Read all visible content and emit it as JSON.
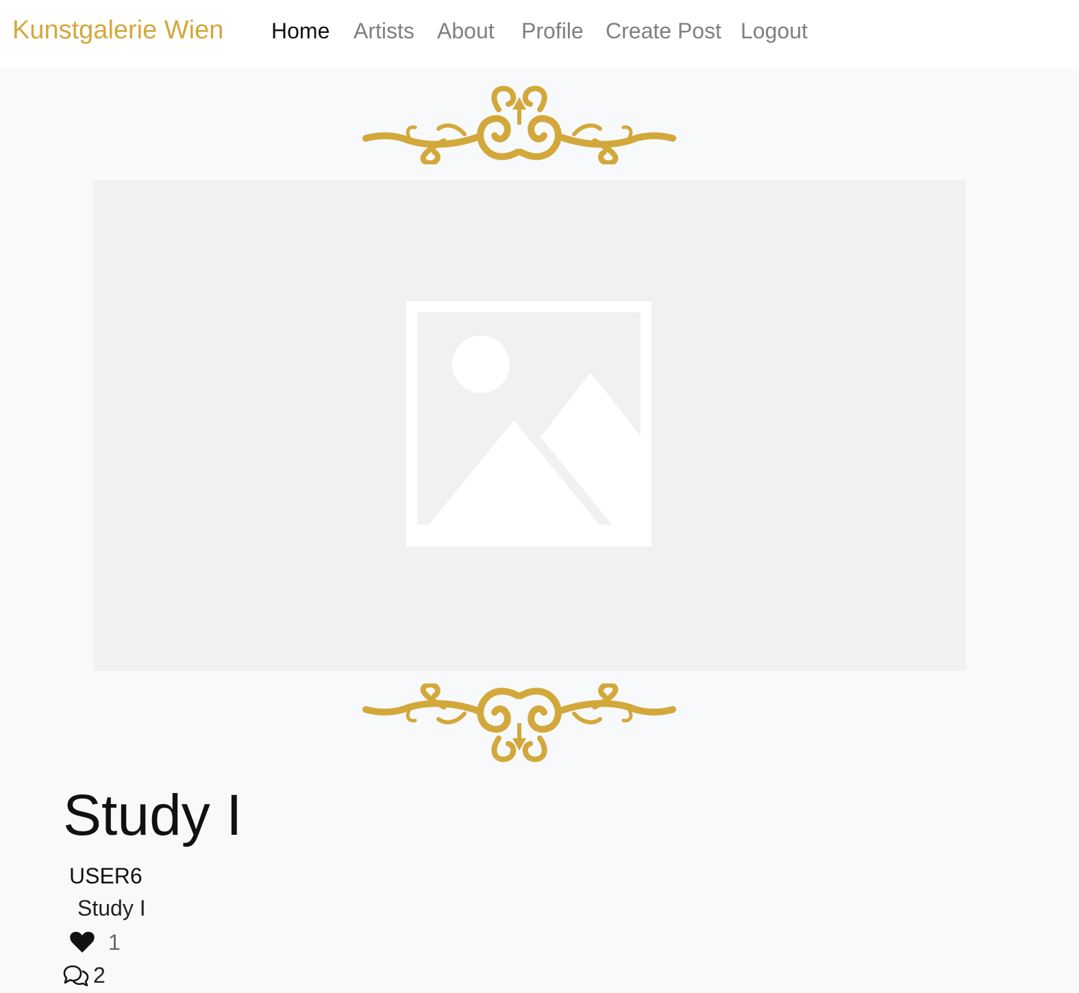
{
  "nav": {
    "brand": "Kunstgalerie Wien",
    "links": [
      {
        "label": "Home",
        "active": true
      },
      {
        "label": "Artists",
        "active": false
      },
      {
        "label": "About",
        "active": false
      },
      {
        "label": "Profile",
        "active": false
      },
      {
        "label": "Create Post",
        "active": false
      },
      {
        "label": "Logout",
        "active": false
      }
    ]
  },
  "colors": {
    "brand_gold": "#d3a83b",
    "page_background": "#f8f9fa",
    "navbar_background": "#ffffff",
    "image_placeholder_background": "#f1f1f1",
    "nav_active": "#111111",
    "nav_inactive": "#7f7f7f"
  },
  "post": {
    "image_icon": "image-placeholder-icon",
    "title": "Study I",
    "author": "USER6",
    "description": "Study I",
    "likes": "1",
    "like_icon": "heart-icon",
    "comments": "2",
    "comment_icon": "comments-icon"
  }
}
